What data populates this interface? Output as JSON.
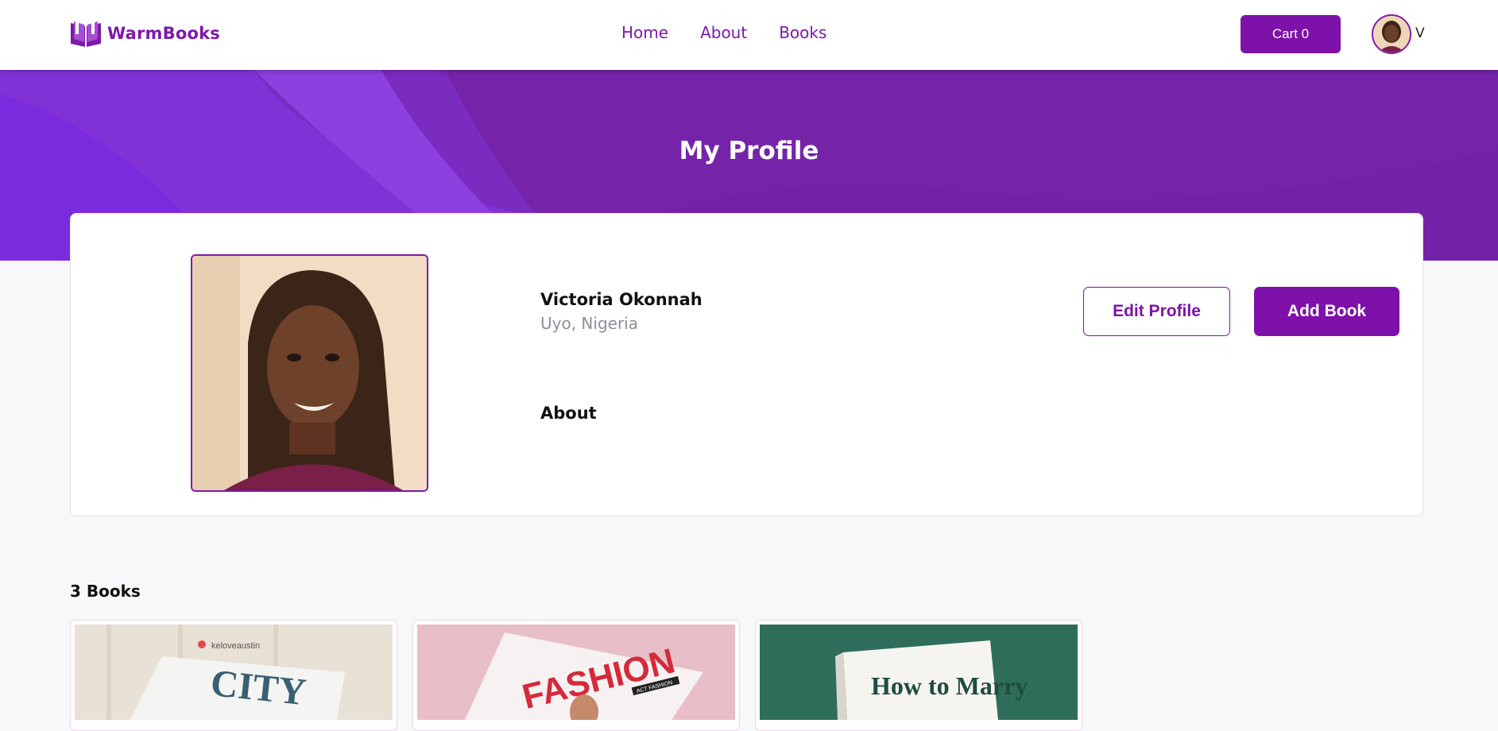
{
  "nav": {
    "brand": "WarmBooks",
    "links": [
      "Home",
      "About",
      "Books"
    ],
    "cart_label": "Cart 0",
    "avatar_initial": "V"
  },
  "hero": {
    "title": "My Profile"
  },
  "profile": {
    "name": "Victoria Okonnah",
    "location": "Uyo,  Nigeria",
    "about_heading": "About",
    "edit_button": "Edit Profile",
    "add_book_button": "Add Book"
  },
  "books": {
    "count_label": "3 Books",
    "items": [
      {
        "cover_text": "CITY",
        "cover_brand": "keloveaustin"
      },
      {
        "cover_text": "FASHION",
        "cover_badge": "ACT FASHION"
      },
      {
        "cover_text": "How to Marry"
      }
    ]
  },
  "colors": {
    "accent": "#7e11a9",
    "hero_base": "#7524a9",
    "page_bg": "#f7f8fa"
  }
}
